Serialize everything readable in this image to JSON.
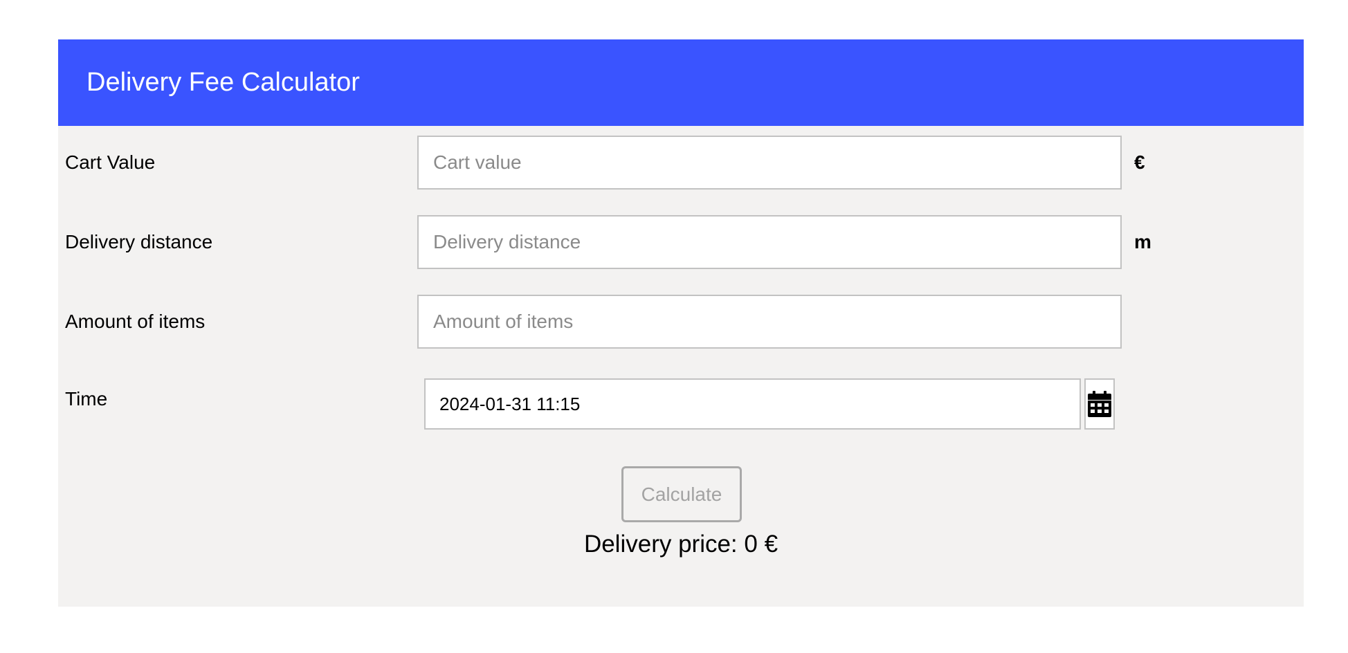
{
  "header": {
    "title": "Delivery Fee Calculator"
  },
  "form": {
    "cart_value": {
      "label": "Cart Value",
      "value": "",
      "placeholder": "Cart value",
      "unit": "€"
    },
    "delivery_distance": {
      "label": "Delivery distance",
      "value": "",
      "placeholder": "Delivery distance",
      "unit": "m"
    },
    "amount_of_items": {
      "label": "Amount of items",
      "value": "",
      "placeholder": "Amount of items"
    },
    "time": {
      "label": "Time",
      "value": "2024-01-31 11:15",
      "icon": "calendar-icon"
    },
    "calculate_label": "Calculate"
  },
  "result": {
    "text": "Delivery price: 0 €"
  },
  "colors": {
    "header_bg": "#3a54ff",
    "panel_bg": "#f3f2f1",
    "input_border": "#c2c2c2"
  }
}
